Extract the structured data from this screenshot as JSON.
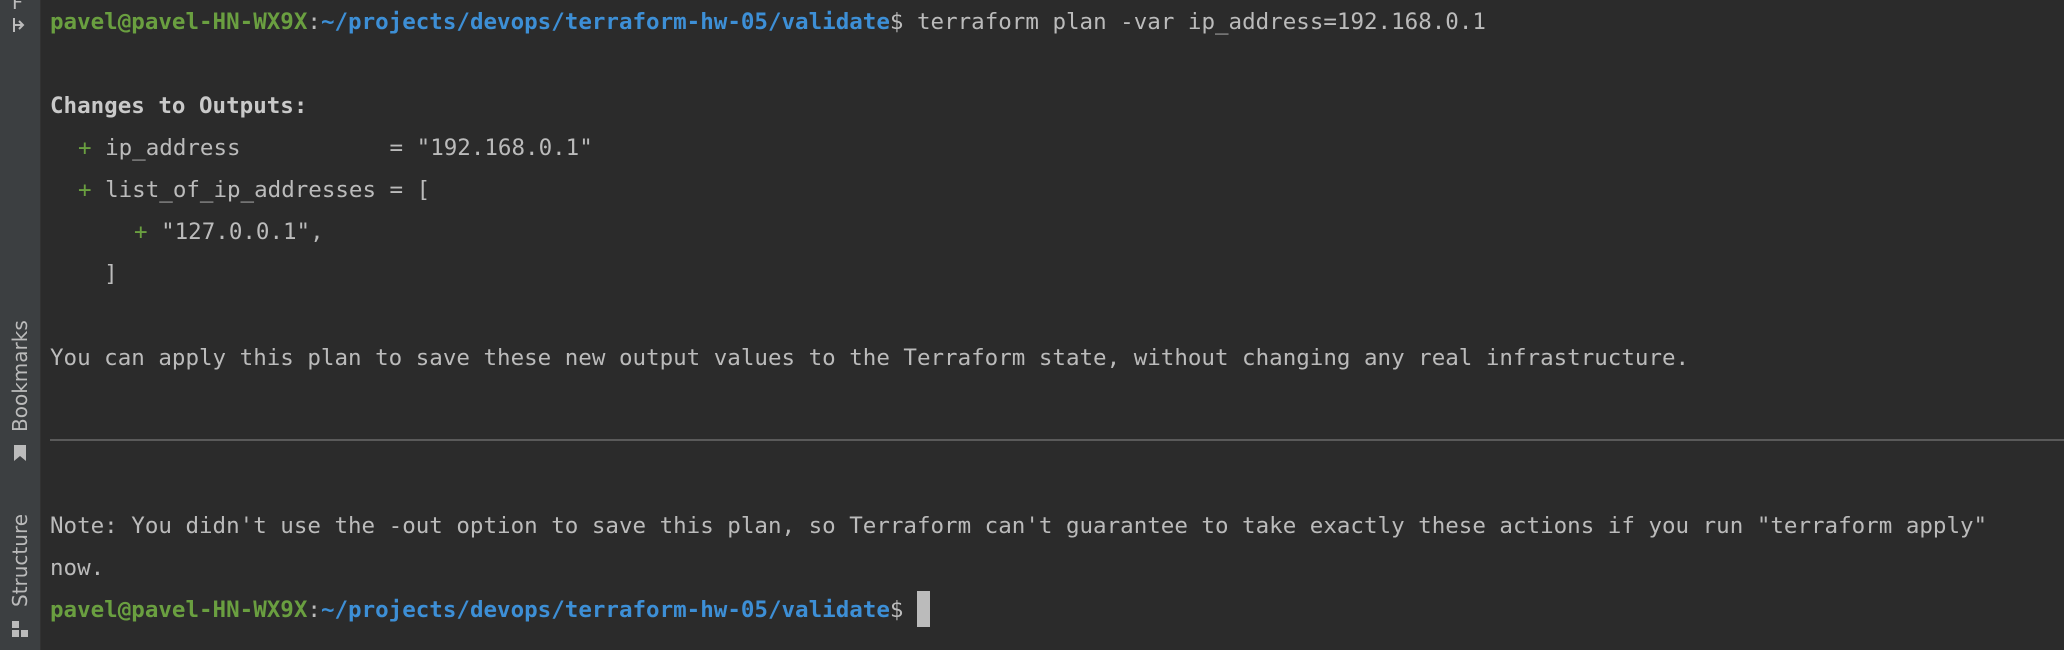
{
  "sidebar": {
    "top_label": "F",
    "bookmarks_label": "Bookmarks",
    "structure_label": "Structure"
  },
  "prompt": {
    "user_host": "pavel@pavel-HN-WX9X",
    "colon": ":",
    "path": "~/projects/devops/terraform-hw-05/validate",
    "dollar": "$",
    "command": " terraform plan -var ip_address=192.168.0.1"
  },
  "output": {
    "heading": "Changes to Outputs:",
    "plus": "+",
    "item1_text": " ip_address           = \"192.168.0.1\"",
    "item2_text": " list_of_ip_addresses = [",
    "nested_text": " \"127.0.0.1\",",
    "close_bracket": "    ]",
    "apply_message": "You can apply this plan to save these new output values to the Terraform state, without changing any real infrastructure.",
    "note_line1": "Note: You didn't use the -out option to save this plan, so Terraform can't guarantee to take exactly these actions if you run \"terraform apply\"",
    "note_line2": "now."
  },
  "colors": {
    "background": "#2b2b2b",
    "prompt_green": "#6a9f40",
    "path_blue": "#3d8fd6",
    "text": "#bbbbbb"
  }
}
